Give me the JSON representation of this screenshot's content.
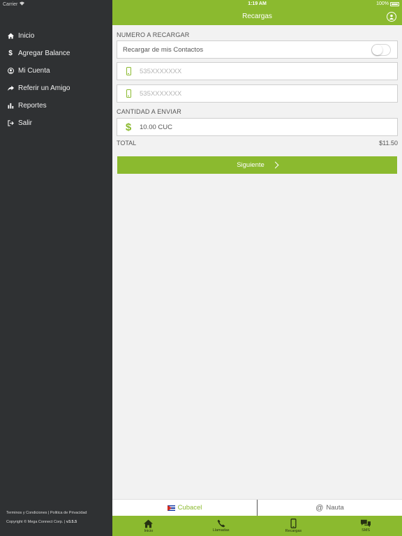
{
  "status_bar": {
    "carrier": "Carrier",
    "time": "1:19 AM",
    "battery": "100%"
  },
  "header": {
    "title": "Recargas"
  },
  "sidebar": {
    "items": [
      {
        "label": "Inicio",
        "icon": "home-icon"
      },
      {
        "label": "Agregar Balance",
        "icon": "dollar-icon"
      },
      {
        "label": "Mi Cuenta",
        "icon": "user-icon"
      },
      {
        "label": "Referir un Amigo",
        "icon": "share-icon"
      },
      {
        "label": "Reportes",
        "icon": "bar-chart-icon"
      },
      {
        "label": "Salir",
        "icon": "logout-icon"
      }
    ],
    "footer": {
      "links": "Terminos y Condiciones | Politica de Privacidad",
      "copyright": "Copyright © Mega Connect Corp. |",
      "version": "v3.5.5"
    }
  },
  "form": {
    "number_section": "NUMERO A RECARGAR",
    "contacts_label": "Recargar de mis Contactos",
    "contacts_toggle_on": false,
    "phone_placeholder_1": "535XXXXXXX",
    "phone_placeholder_2": "535XXXXXXX",
    "amount_section": "CANTIDAD A ENVIAR",
    "amount_value": "10.00 CUC",
    "total_label": "TOTAL",
    "total_value": "$11.50",
    "next_label": "Siguiente"
  },
  "segment": {
    "cubacel": "Cubacel",
    "nauta": "Nauta",
    "selected": "Cubacel"
  },
  "tabs": [
    {
      "label": "Inicio",
      "icon": "home-icon"
    },
    {
      "label": "Llamadas",
      "icon": "phone-icon"
    },
    {
      "label": "Recargas",
      "icon": "mobile-icon"
    },
    {
      "label": "SMS",
      "icon": "chat-icon"
    }
  ],
  "colors": {
    "accent": "#8bba2f",
    "sidebar": "#2f3133",
    "background": "#f2f2f2"
  }
}
